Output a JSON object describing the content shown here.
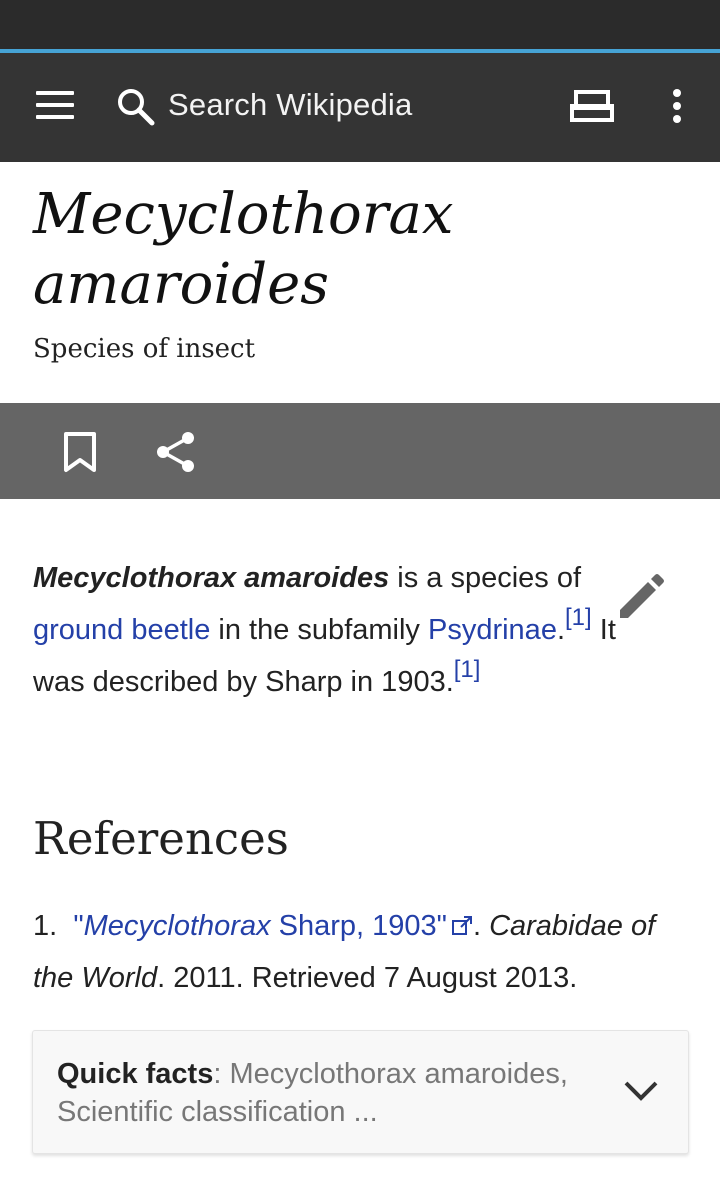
{
  "toolbar": {
    "search_placeholder": "Search Wikipedia"
  },
  "icons": {
    "menu": "menu-icon",
    "search": "search-icon",
    "reading_list": "reading-list-icon",
    "overflow": "overflow-menu-icon",
    "bookmark": "bookmark-icon",
    "share": "share-icon",
    "edit": "edit-pencil-icon",
    "external_link": "external-link-icon",
    "expand": "chevron-down-icon"
  },
  "colors": {
    "toolbar_bg": "#343434",
    "status_bar_bg": "#2b2b2b",
    "progress_accent": "#46a3d5",
    "action_bar_bg": "#656565",
    "link": "#2440a8"
  },
  "article": {
    "title_line1": "Mecyclothorax",
    "title_line2": "amaroides",
    "description": "Species of insect",
    "intro": {
      "subject": "Mecyclothorax amaroides",
      "text1": " is a species of ",
      "link1": "ground beetle",
      "text2": " in the subfamily ",
      "link2": "Psydrinae",
      "text3": ".",
      "cite1": "[1]",
      "text4": " It was described by Sharp in 1903.",
      "cite2": "[1]"
    }
  },
  "references": {
    "heading": "References",
    "items": [
      {
        "number": "1.",
        "link_open_quote": "\"",
        "link_italic": "Mecyclothorax",
        "link_rest": " Sharp, 1903\"",
        "after_link": ". ",
        "work": "Carabidae of the World",
        "rest": ". 2011. Retrieved 7 August 2013."
      }
    ]
  },
  "quick_facts": {
    "label": "Quick facts",
    "separator": ": ",
    "summary": "Mecyclothorax amaroides, Scientific classification ..."
  }
}
